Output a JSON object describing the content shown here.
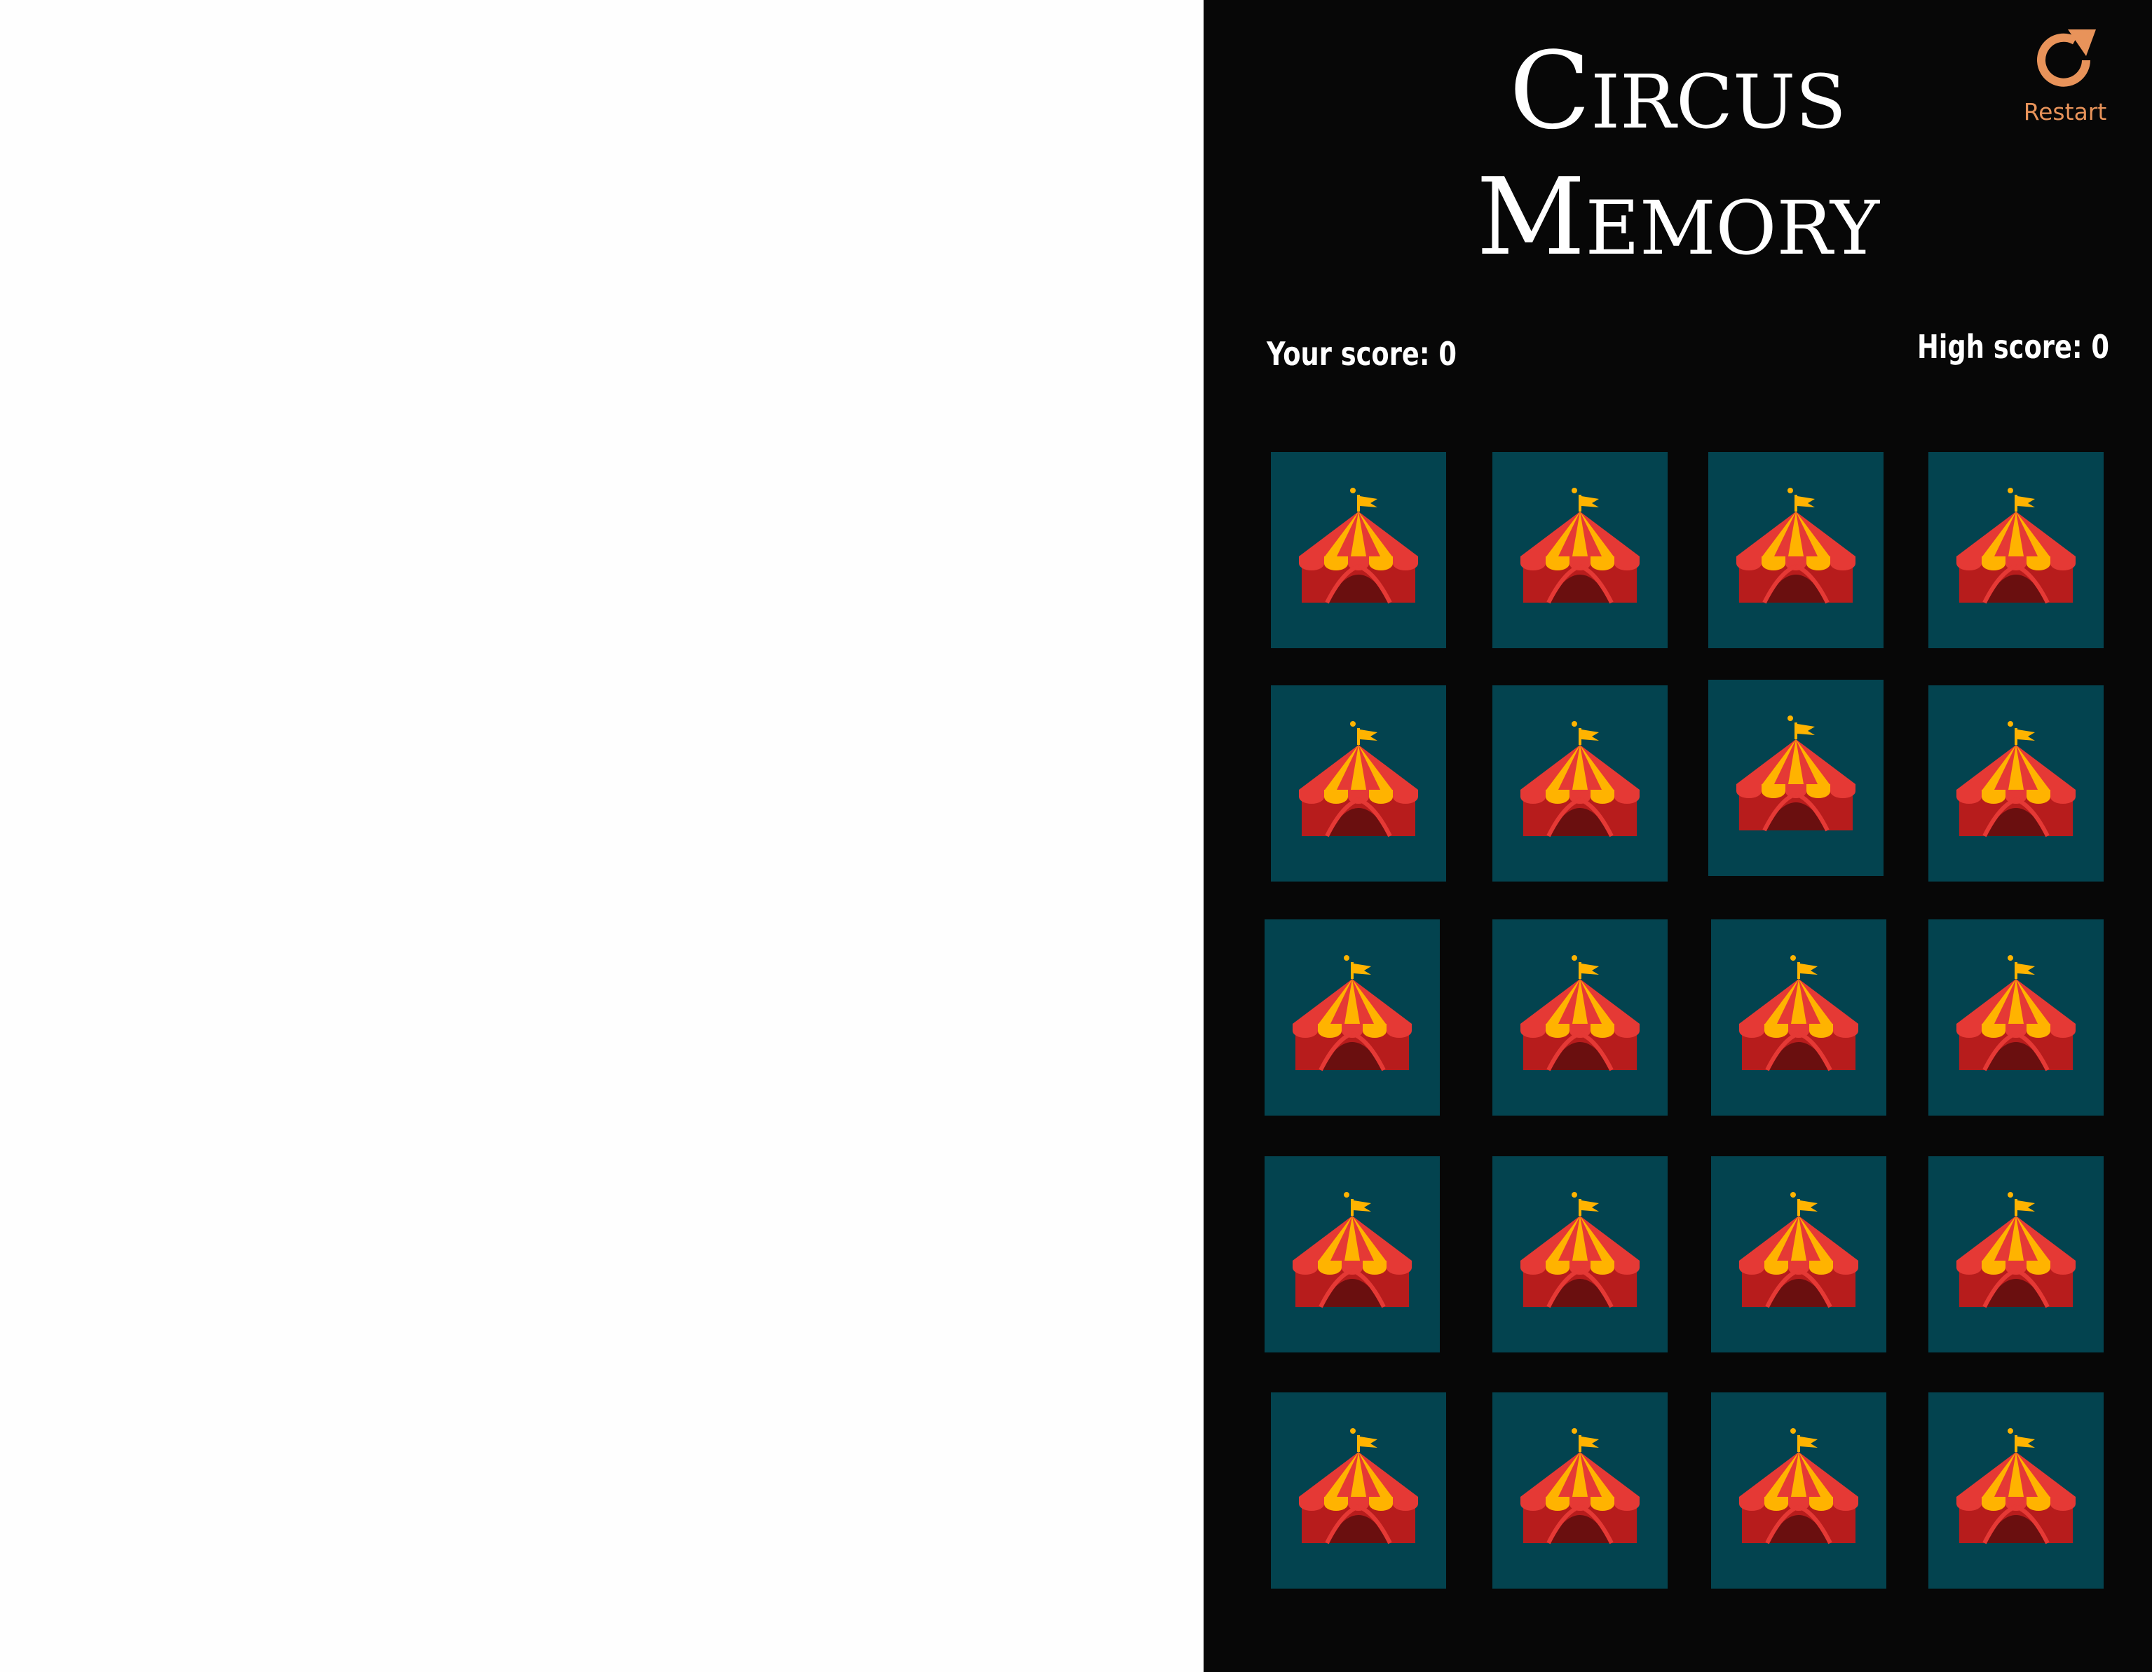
{
  "game": {
    "title_line1": "Circus",
    "title_line2": "Memory",
    "restart_label": "Restart",
    "your_score_label": "Your score:",
    "your_score_value": 0,
    "high_score_label": "High score:",
    "high_score_value": 0,
    "grid_rows": 5,
    "grid_cols": 4,
    "card_back_icon": "circus-tent-icon",
    "card_state": "face-down"
  },
  "colors": {
    "panel_background": "#070707",
    "card_background": "#03434f",
    "title_text": "#ffffff",
    "restart_accent": "#e8935a",
    "tent_red": "#b71c1c",
    "tent_stripe_red": "#e53935",
    "tent_stripe_yellow": "#ffb300",
    "tent_door": "#6a0f0f"
  }
}
